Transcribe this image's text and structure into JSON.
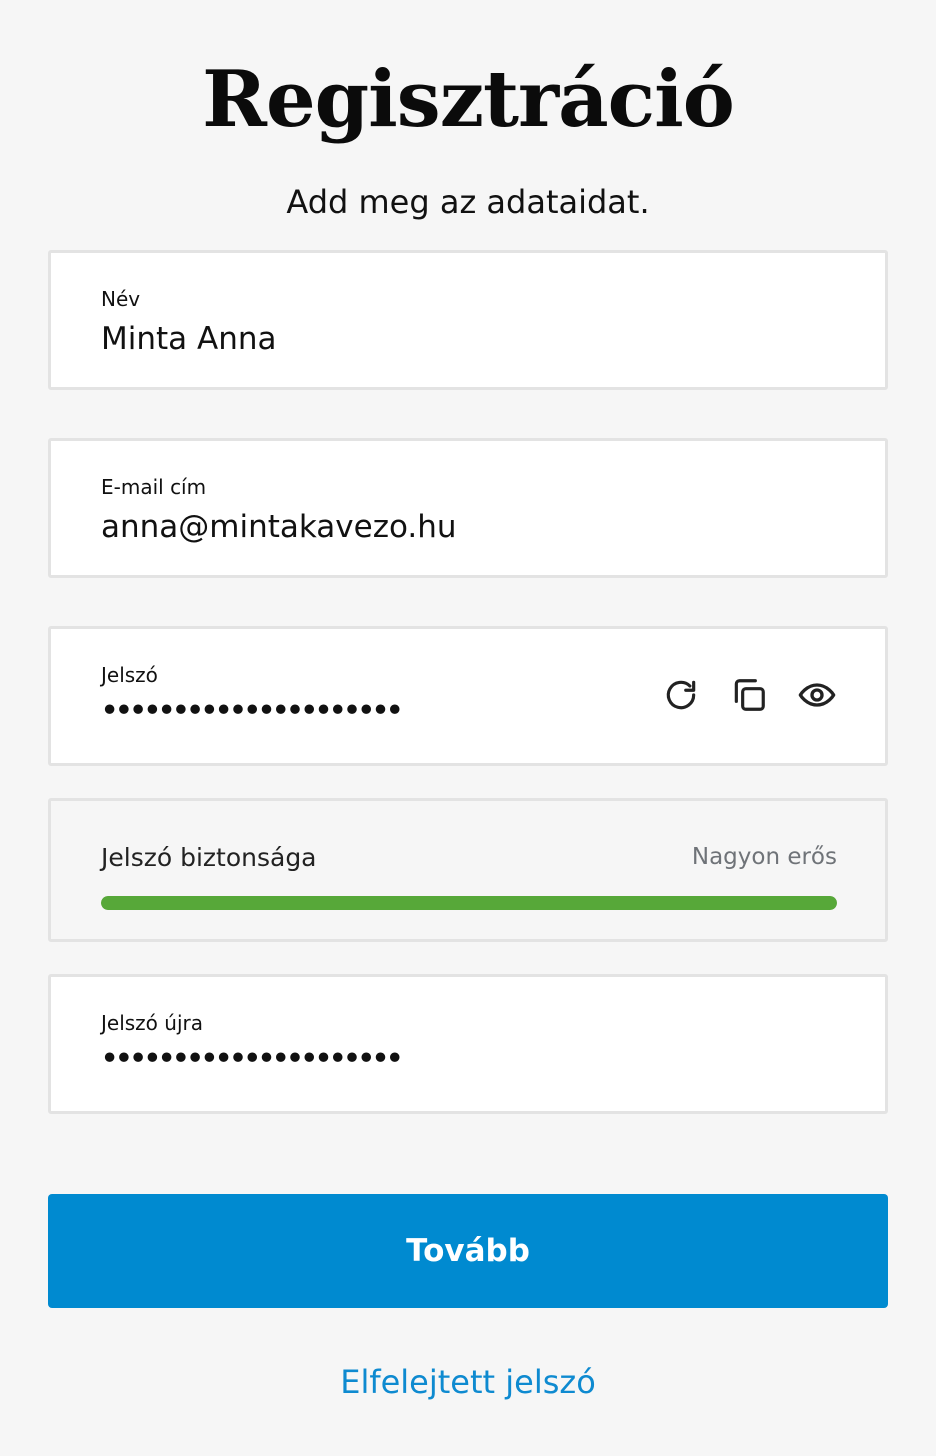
{
  "header": {
    "title": "Regisztráció",
    "subtitle": "Add meg az adataidat."
  },
  "form": {
    "name": {
      "label": "Név",
      "value": "Minta Anna"
    },
    "email": {
      "label": "E-mail cím",
      "value": "anna@mintakavezo.hu"
    },
    "password": {
      "label": "Jelszó",
      "value": "•••••••••••••••••••••",
      "icons": [
        "refresh-icon",
        "copy-icon",
        "eye-icon"
      ]
    },
    "strength": {
      "label": "Jelszó biztonsága",
      "value": "Nagyon erős",
      "level_fraction": 1.0,
      "color": "#57a839"
    },
    "password_repeat": {
      "label": "Jelszó újra",
      "value": "•••••••••••••••••••••"
    }
  },
  "actions": {
    "submit_label": "Tovább",
    "forgot_label": "Elfelejtett jelszó"
  },
  "colors": {
    "accent": "#008ad0",
    "link": "#0e8ad0",
    "background": "#f6f6f6"
  }
}
